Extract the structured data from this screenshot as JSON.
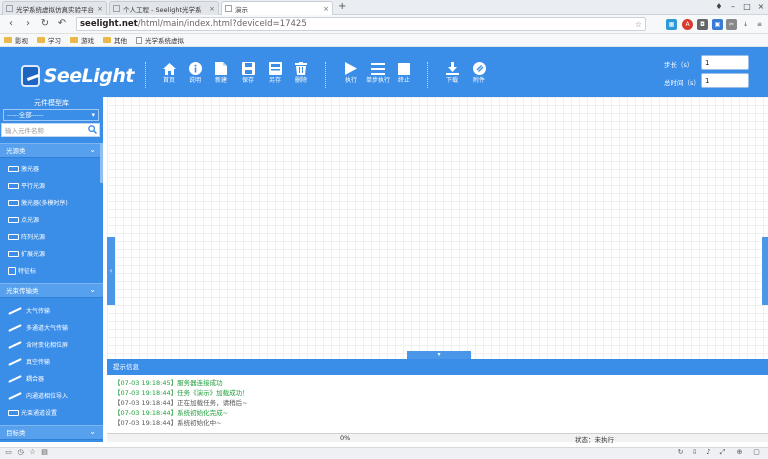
{
  "browser": {
    "tabs": [
      {
        "title": "光学系统虚拟仿真实验平台",
        "active": false
      },
      {
        "title": "个人工程 - Seelight光学系",
        "active": false
      },
      {
        "title": "演示",
        "active": true
      }
    ],
    "new_tab_label": "+",
    "url_host": "seelight.net",
    "url_path": "/html/main/index.html?deviceId=17425",
    "bookmarks": [
      "影视",
      "学习",
      "游戏",
      "其他",
      "光学系统虚拟"
    ]
  },
  "app": {
    "logo_text": "SeeLight",
    "toolbar": [
      {
        "label": "首页",
        "icon": "home-icon"
      },
      {
        "label": "说明",
        "icon": "info-icon"
      },
      {
        "label": "新建",
        "icon": "new-file-icon"
      },
      {
        "label": "保存",
        "icon": "save-icon"
      },
      {
        "label": "另存",
        "icon": "save-as-icon"
      },
      {
        "label": "删除",
        "icon": "delete-icon"
      },
      {
        "label": "执行",
        "icon": "play-icon"
      },
      {
        "label": "单步执行",
        "icon": "step-icon"
      },
      {
        "label": "终止",
        "icon": "stop-icon"
      },
      {
        "label": "下载",
        "icon": "download-icon"
      },
      {
        "label": "附件",
        "icon": "attachment-icon"
      }
    ],
    "step": {
      "label": "步长（s）",
      "value": "1"
    },
    "total_time": {
      "label": "总时间（s）",
      "value": "1"
    }
  },
  "sidebar": {
    "title": "元件模型库",
    "filter": "-----全部-----",
    "search_placeholder": "输入元件名称",
    "sections": [
      {
        "label": "光源类",
        "items": [
          "激光器",
          "平行光源",
          "激光器(多模时序)",
          "点光源",
          "阵列光源",
          "扩展光源",
          "特征标"
        ]
      },
      {
        "label": "光束传输类",
        "items": [
          "大气传输",
          "多通道大气传输",
          "含时变化相位屏",
          "真空传输",
          "耦合器",
          "内通道相位导入",
          "光束通道设置"
        ]
      },
      {
        "label": "目标类",
        "items": []
      }
    ]
  },
  "log": {
    "title": "提示信息",
    "lines": [
      {
        "text": "【07-03 19:18:45】服务器连接成功",
        "color": "#1e9e3a"
      },
      {
        "text": "【07-03 19:18:44】任务《演示》加载成功！",
        "color": "#1e9e3a"
      },
      {
        "text": "【07-03 19:18:44】正在加载任务，请稍后~",
        "color": "#555555"
      },
      {
        "text": "【07-03 19:18:44】系统初始化完成~",
        "color": "#1e9e3a"
      },
      {
        "text": "【07-03 19:18:44】系统初始化中~",
        "color": "#555555"
      }
    ]
  },
  "status": {
    "progress": "0%",
    "state": "状态：未执行"
  },
  "colors": {
    "brand": "#3a8ee8",
    "section": "#56a0ee",
    "log_success": "#1e9e3a"
  }
}
